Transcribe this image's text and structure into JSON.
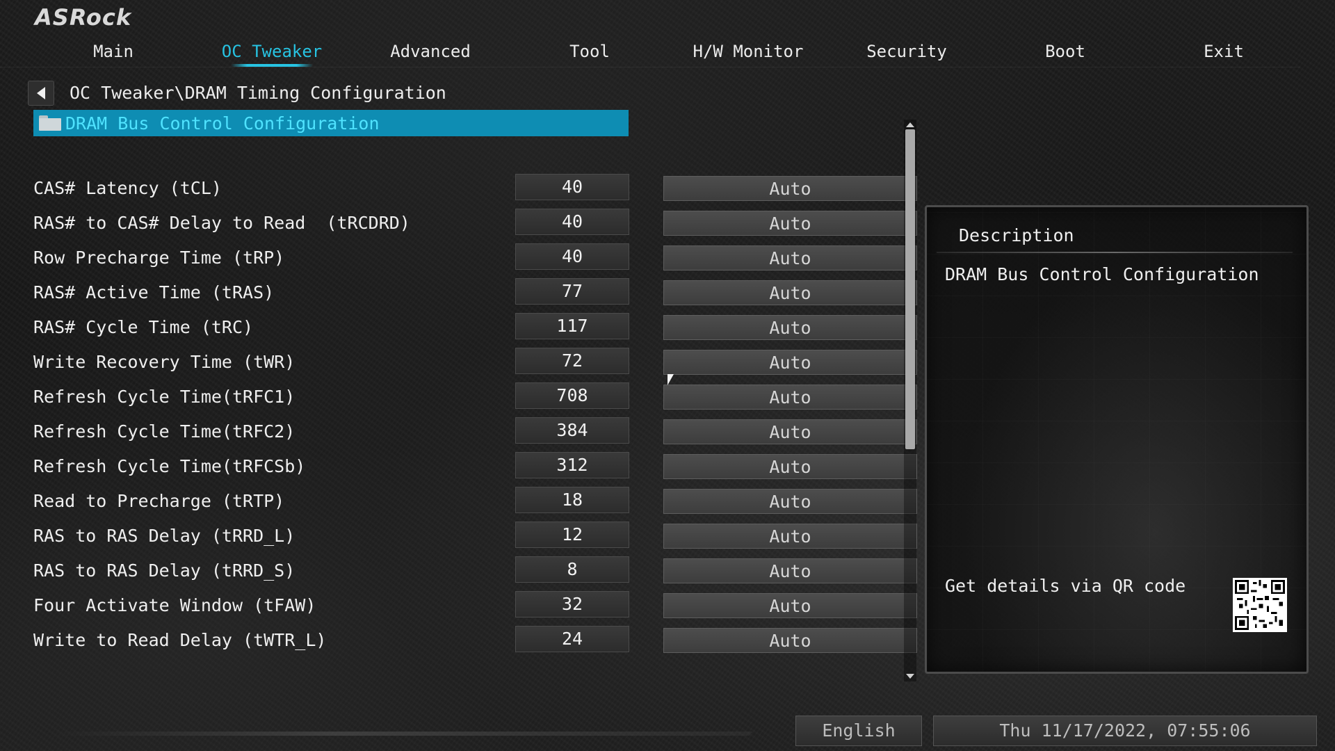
{
  "brand": "ASRock",
  "nav": [
    {
      "label": "Main",
      "active": false
    },
    {
      "label": "OC Tweaker",
      "active": true
    },
    {
      "label": "Advanced",
      "active": false
    },
    {
      "label": "Tool",
      "active": false
    },
    {
      "label": "H/W Monitor",
      "active": false
    },
    {
      "label": "Security",
      "active": false
    },
    {
      "label": "Boot",
      "active": false
    },
    {
      "label": "Exit",
      "active": false
    }
  ],
  "breadcrumb": "OC Tweaker\\DRAM Timing Configuration",
  "selected_item": "DRAM Bus Control Configuration",
  "settings": [
    {
      "label": "CAS# Latency (tCL)",
      "value": "40",
      "option": "Auto"
    },
    {
      "label": "RAS# to CAS# Delay to Read  (tRCDRD)",
      "value": "40",
      "option": "Auto"
    },
    {
      "label": "Row Precharge Time (tRP)",
      "value": "40",
      "option": "Auto"
    },
    {
      "label": "RAS# Active Time (tRAS)",
      "value": "77",
      "option": "Auto"
    },
    {
      "label": "RAS# Cycle Time (tRC)",
      "value": "117",
      "option": "Auto"
    },
    {
      "label": "Write Recovery Time (tWR)",
      "value": "72",
      "option": "Auto"
    },
    {
      "label": "Refresh Cycle Time(tRFC1)",
      "value": "708",
      "option": "Auto"
    },
    {
      "label": "Refresh Cycle Time(tRFC2)",
      "value": "384",
      "option": "Auto"
    },
    {
      "label": "Refresh Cycle Time(tRFCSb)",
      "value": "312",
      "option": "Auto"
    },
    {
      "label": "Read to Precharge (tRTP)",
      "value": "18",
      "option": "Auto"
    },
    {
      "label": "RAS to RAS Delay (tRRD_L)",
      "value": "12",
      "option": "Auto"
    },
    {
      "label": "RAS to RAS Delay (tRRD_S)",
      "value": "8",
      "option": "Auto"
    },
    {
      "label": "Four Activate Window (tFAW)",
      "value": "32",
      "option": "Auto"
    },
    {
      "label": "Write to Read Delay (tWTR_L)",
      "value": "24",
      "option": "Auto"
    }
  ],
  "description": {
    "title": "Description",
    "text": "DRAM Bus Control Configuration",
    "qr_label": "Get details via QR code"
  },
  "footer": {
    "language": "English",
    "datetime": "Thu 11/17/2022, 07:55:06"
  },
  "colors": {
    "accent": "#27c3e2",
    "selection_bg": "#0e8db3",
    "selection_text": "#4fe3ff"
  },
  "icons": [
    "back-arrow-icon",
    "folder-icon",
    "qr-code-icon",
    "mouse-cursor-icon"
  ]
}
